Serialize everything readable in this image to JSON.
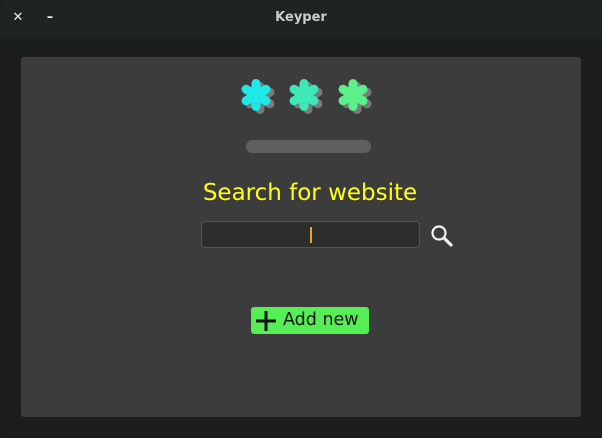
{
  "window": {
    "title": "Keyper",
    "close_glyph": "✕",
    "minimize_glyph": "–"
  },
  "logo": {
    "icon": "three-asterisks-logo",
    "colors": [
      "#1fe8e8",
      "#3de8b8",
      "#5cf08a"
    ]
  },
  "strength_bar": {
    "color": "#5f5f5f"
  },
  "search": {
    "heading": "Search for website",
    "value": "",
    "icon": "magnifier-icon"
  },
  "add_button": {
    "label": "Add new",
    "icon": "plus-icon",
    "color": "#55ee55"
  },
  "colors": {
    "window_bg": "#1c1e1e",
    "panel_bg": "#3c3c3c",
    "heading": "#ffff1c",
    "caret": "#e9a52a"
  }
}
